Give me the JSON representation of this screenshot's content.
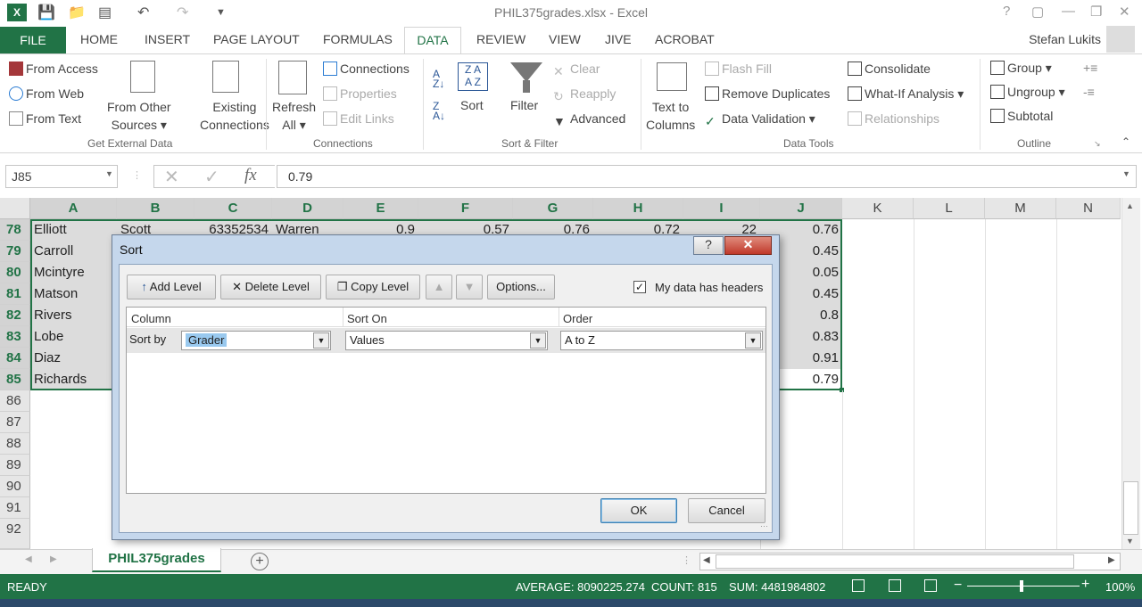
{
  "window": {
    "title": "PHIL375grades.xlsx - Excel",
    "user": "Stefan Lukits"
  },
  "tabs": [
    "FILE",
    "HOME",
    "INSERT",
    "PAGE LAYOUT",
    "FORMULAS",
    "DATA",
    "REVIEW",
    "VIEW",
    "JIVE",
    "ACROBAT"
  ],
  "ribbon": {
    "get_external": {
      "from_access": "From Access",
      "from_web": "From Web",
      "from_text": "From Text",
      "from_other_1": "From Other",
      "from_other_2": "Sources",
      "existing_1": "Existing",
      "existing_2": "Connections",
      "label": "Get External Data"
    },
    "connections": {
      "refresh_1": "Refresh",
      "refresh_2": "All",
      "connections": "Connections",
      "properties": "Properties",
      "edit_links": "Edit Links",
      "label": "Connections"
    },
    "sort_filter": {
      "sort": "Sort",
      "filter": "Filter",
      "clear": "Clear",
      "reapply": "Reapply",
      "advanced": "Advanced",
      "label": "Sort & Filter"
    },
    "data_tools": {
      "text_1": "Text to",
      "text_2": "Columns",
      "flash_fill": "Flash Fill",
      "remove_dup": "Remove Duplicates",
      "validation": "Data Validation",
      "consolidate": "Consolidate",
      "what_if": "What-If Analysis",
      "relationships": "Relationships",
      "label": "Data Tools"
    },
    "outline": {
      "group": "Group",
      "ungroup": "Ungroup",
      "subtotal": "Subtotal",
      "label": "Outline"
    }
  },
  "formula": {
    "namebox": "J85",
    "value": "0.79"
  },
  "columns": [
    "A",
    "B",
    "C",
    "D",
    "E",
    "F",
    "G",
    "H",
    "I",
    "J",
    "K",
    "L",
    "M",
    "N"
  ],
  "rows": [
    {
      "n": "78",
      "a": "Elliott",
      "b": "Scott",
      "c": "63352534",
      "d": "Warren",
      "e": "0.9",
      "f": "0.57",
      "g": "0.76",
      "h": "0.72",
      "i": "22",
      "j": "0.76"
    },
    {
      "n": "79",
      "a": "Carroll",
      "j": "0.45"
    },
    {
      "n": "80",
      "a": "Mcintyre",
      "j": "0.05"
    },
    {
      "n": "81",
      "a": "Matson",
      "j": "0.45"
    },
    {
      "n": "82",
      "a": "Rivers",
      "j": "0.8"
    },
    {
      "n": "83",
      "a": "Lobe",
      "j": "0.83"
    },
    {
      "n": "84",
      "a": "Diaz",
      "j": "0.91"
    },
    {
      "n": "85",
      "a": "Richards",
      "j": "0.79"
    },
    {
      "n": "86"
    },
    {
      "n": "87"
    },
    {
      "n": "88"
    },
    {
      "n": "89"
    },
    {
      "n": "90"
    },
    {
      "n": "91"
    },
    {
      "n": "92"
    }
  ],
  "sheet": {
    "name": "PHIL375grades"
  },
  "status": {
    "ready": "READY",
    "average": "AVERAGE: 8090225.274",
    "count": "COUNT: 815",
    "sum": "SUM: 4481984802",
    "zoom": "100%"
  },
  "dialog": {
    "title": "Sort",
    "add_level": "Add Level",
    "delete_level": "Delete Level",
    "copy_level": "Copy Level",
    "options": "Options...",
    "headers_label": "My data has headers",
    "col_header": "Column",
    "sorton_header": "Sort On",
    "order_header": "Order",
    "sort_by": "Sort by",
    "column_value": "Grader",
    "sorton_value": "Values",
    "order_value": "A to Z",
    "ok": "OK",
    "cancel": "Cancel"
  }
}
